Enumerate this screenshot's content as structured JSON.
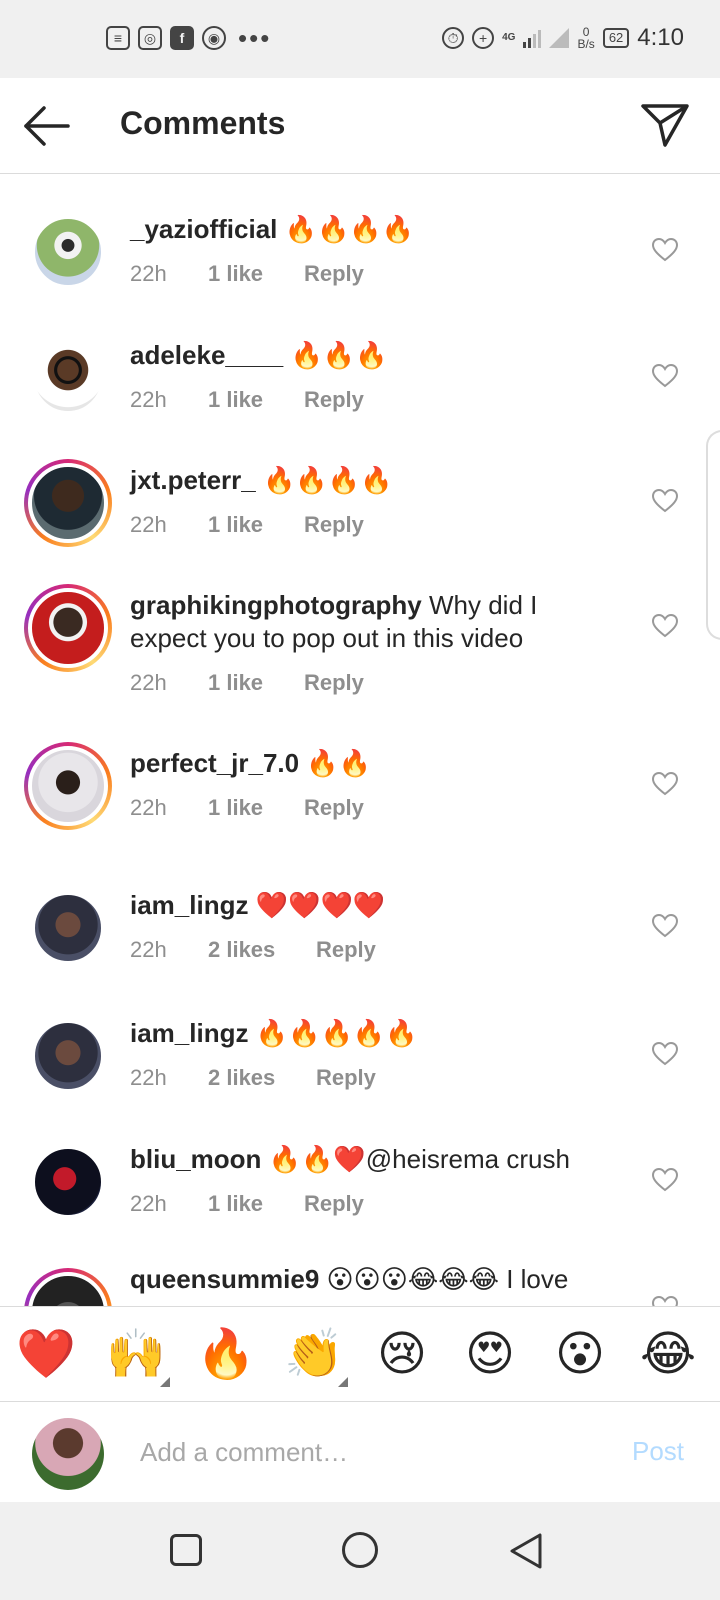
{
  "status": {
    "time": "4:10",
    "network": "4G",
    "speed_value": "0",
    "speed_unit": "B/s",
    "battery": "62"
  },
  "header": {
    "title": "Comments"
  },
  "comments": [
    {
      "username": "_yaziofficial",
      "text": "🔥🔥🔥🔥",
      "time": "22h",
      "likes": "1 like",
      "reply": "Reply"
    },
    {
      "username": "adeleke____",
      "text": "🔥🔥🔥",
      "time": "22h",
      "likes": "1 like",
      "reply": "Reply"
    },
    {
      "username": "jxt.peterr_",
      "text": "🔥🔥🔥🔥",
      "time": "22h",
      "likes": "1 like",
      "reply": "Reply"
    },
    {
      "username": "graphikingphotography",
      "text": "Why did I expect you to pop out in this video",
      "time": "22h",
      "likes": "1 like",
      "reply": "Reply"
    },
    {
      "username": "perfect_jr_7.0",
      "text": "🔥🔥",
      "time": "22h",
      "likes": "1 like",
      "reply": "Reply"
    },
    {
      "username": "iam_lingz",
      "text": "❤️❤️❤️❤️",
      "time": "22h",
      "likes": "2 likes",
      "reply": "Reply"
    },
    {
      "username": "iam_lingz",
      "text": "🔥🔥🔥🔥🔥",
      "time": "22h",
      "likes": "2 likes",
      "reply": "Reply"
    },
    {
      "username": "bliu_moon",
      "text": "🔥🔥❤️@heisrema crush",
      "time": "22h",
      "likes": "1 like",
      "reply": "Reply"
    },
    {
      "username": "queensummie9",
      "text": "😮😮😮😂😂😂 I love",
      "time": "",
      "likes": "",
      "reply": ""
    }
  ],
  "emoji_bar": [
    "❤️",
    "🙌",
    "🔥",
    "👏",
    "😢",
    "😍",
    "😮",
    "😂"
  ],
  "add_comment": {
    "placeholder": "Add a comment…",
    "post_label": "Post"
  },
  "colors": {
    "link_blue_disabled": "#b3dbff",
    "meta_gray": "#8e8e8e",
    "divider": "#dbdbdb"
  }
}
